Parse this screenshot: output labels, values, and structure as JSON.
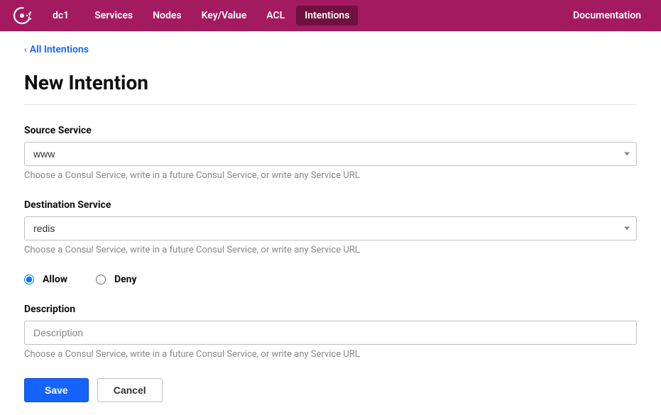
{
  "navbar": {
    "dc": "dc1",
    "items": [
      "Services",
      "Nodes",
      "Key/Value",
      "ACL",
      "Intentions"
    ],
    "active_index": 4,
    "documentation": "Documentation"
  },
  "breadcrumb": {
    "label": "All Intentions"
  },
  "page_title": "New Intention",
  "form": {
    "source": {
      "label": "Source Service",
      "value": "www",
      "helper": "Choose a Consul Service, write in a future Consul Service, or write any Service URL"
    },
    "destination": {
      "label": "Destination Service",
      "value": "redis",
      "helper": "Choose a Consul Service, write in a future Consul Service, or write any Service URL"
    },
    "action": {
      "allow_label": "Allow",
      "deny_label": "Deny",
      "selected": "allow"
    },
    "description": {
      "label": "Description",
      "placeholder": "Description",
      "value": "",
      "helper": "Choose a Consul Service, write in a future Consul Service, or write any Service URL"
    },
    "buttons": {
      "save": "Save",
      "cancel": "Cancel"
    }
  }
}
